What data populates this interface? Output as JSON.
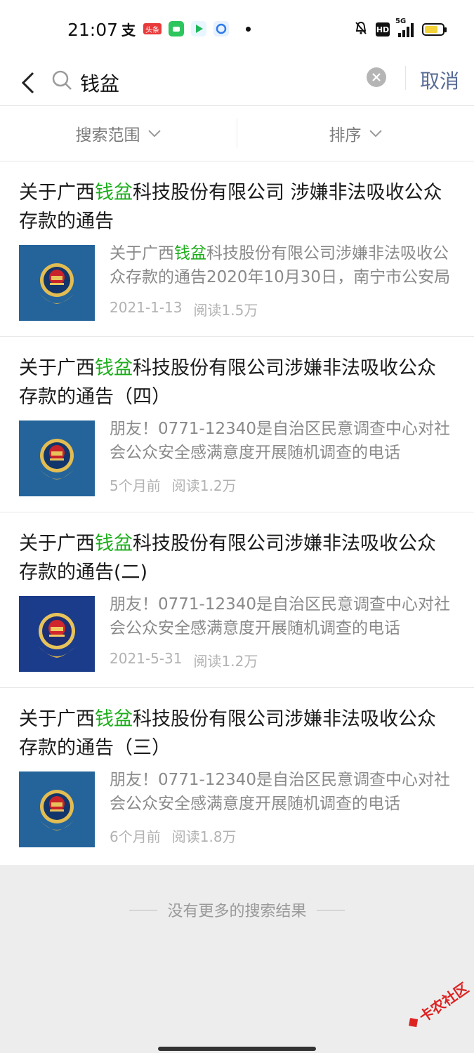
{
  "status_bar": {
    "time": "21:07",
    "left_icons": [
      "alipay-icon",
      "toutiao-icon",
      "wechat-icon",
      "video-icon",
      "browser-icon"
    ],
    "toutiao_label": "头条",
    "alipay_glyph": "支",
    "hd_label": "HD",
    "network_label": "5G"
  },
  "search": {
    "query": "钱盆",
    "cancel_label": "取消"
  },
  "filters": {
    "scope_label": "搜索范围",
    "sort_label": "排序"
  },
  "colors": {
    "highlight": "#1aad19",
    "link": "#576b95"
  },
  "results": [
    {
      "title_pre": "关于广西",
      "title_hl": "钱盆",
      "title_post": "科技股份有限公司 涉嫌非法吸收公众存款的通告",
      "snippet_pre": "关于广西",
      "snippet_hl": "钱盆",
      "snippet_post": "科技股份有限公司涉嫌非法吸收公众存款的通告2020年10月30日，南宁市公安局",
      "date": "2021-1-13",
      "reads": "阅读1.5万",
      "thumb_variant": "badge-blue"
    },
    {
      "title_pre": "关于广西",
      "title_hl": "钱盆",
      "title_post": "科技股份有限公司涉嫌非法吸收公众存款的通告（四）",
      "snippet_pre": "",
      "snippet_hl": "",
      "snippet_post": "朋友！0771-12340是自治区民意调查中心对社会公众安全感满意度开展随机调查的电话",
      "date": "5个月前",
      "reads": "阅读1.2万",
      "thumb_variant": "badge-blue"
    },
    {
      "title_pre": "关于广西",
      "title_hl": "钱盆",
      "title_post": "科技股份有限公司涉嫌非法吸收公众存款的通告(二)",
      "snippet_pre": "",
      "snippet_hl": "",
      "snippet_post": "朋友！0771-12340是自治区民意调查中心对社会公众安全感满意度开展随机调查的电话",
      "date": "2021-5-31",
      "reads": "阅读1.2万",
      "thumb_variant": "badge-navy"
    },
    {
      "title_pre": "关于广西",
      "title_hl": "钱盆",
      "title_post": "科技股份有限公司涉嫌非法吸收公众存款的通告（三）",
      "snippet_pre": "",
      "snippet_hl": "",
      "snippet_post": "朋友！0771-12340是自治区民意调查中心对社会公众安全感满意度开展随机调查的电话",
      "date": "6个月前",
      "reads": "阅读1.8万",
      "thumb_variant": "badge-blue"
    }
  ],
  "footer": {
    "no_more": "没有更多的搜索结果"
  },
  "watermark": "卡农社区"
}
